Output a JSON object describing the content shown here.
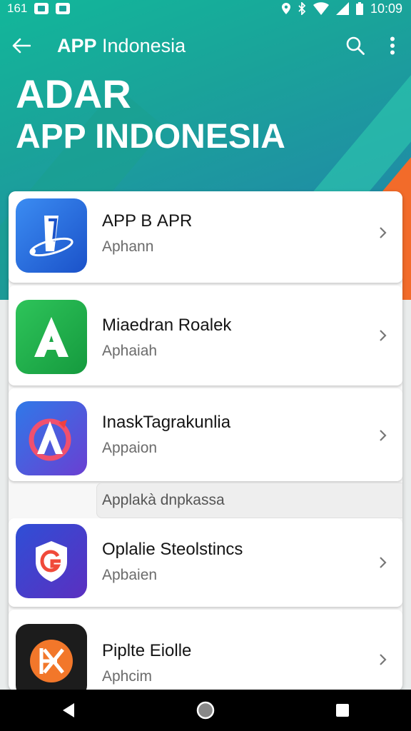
{
  "status_bar": {
    "left_text": "161",
    "time": "10:09",
    "icons": [
      "notification-app-icon",
      "notification-app-icon",
      "location-icon",
      "bluetooth-icon",
      "wifi-icon",
      "signal-icon",
      "battery-icon"
    ]
  },
  "toolbar": {
    "title_bold": "APP",
    "title_rest": " Indonesia",
    "icons": [
      "back-arrow-icon",
      "search-icon",
      "more-vert-icon"
    ]
  },
  "headline": {
    "line1": "ADAR",
    "line2": "APP INDONESIA"
  },
  "colors": {
    "banner_teal": "#1aa39a",
    "banner_orange": "#f26b2a",
    "card_bg": "#ffffff",
    "nav_bg": "#000000"
  },
  "apps": [
    {
      "title": "APP В APR",
      "subtitle": "Aphann",
      "icon": "blue-app-icon"
    },
    {
      "title": "Miaedran Roalek",
      "subtitle": "Aphaiah",
      "icon": "green-a-app-icon"
    },
    {
      "title": "InaskTagrakunlia",
      "subtitle": "Appaion",
      "icon": "colorful-a-app-icon"
    },
    {
      "title": "Oplalie Steolstincs",
      "subtitle": "Apbaien",
      "icon": "shield-app-icon"
    },
    {
      "title": "Piplte Eiolle",
      "subtitle": "Aphcim",
      "icon": "orange-star-app-icon"
    }
  ],
  "section_label": "Applakà dnpkassa",
  "nav": [
    "back-triangle-icon",
    "home-circle-icon",
    "recents-square-icon"
  ]
}
